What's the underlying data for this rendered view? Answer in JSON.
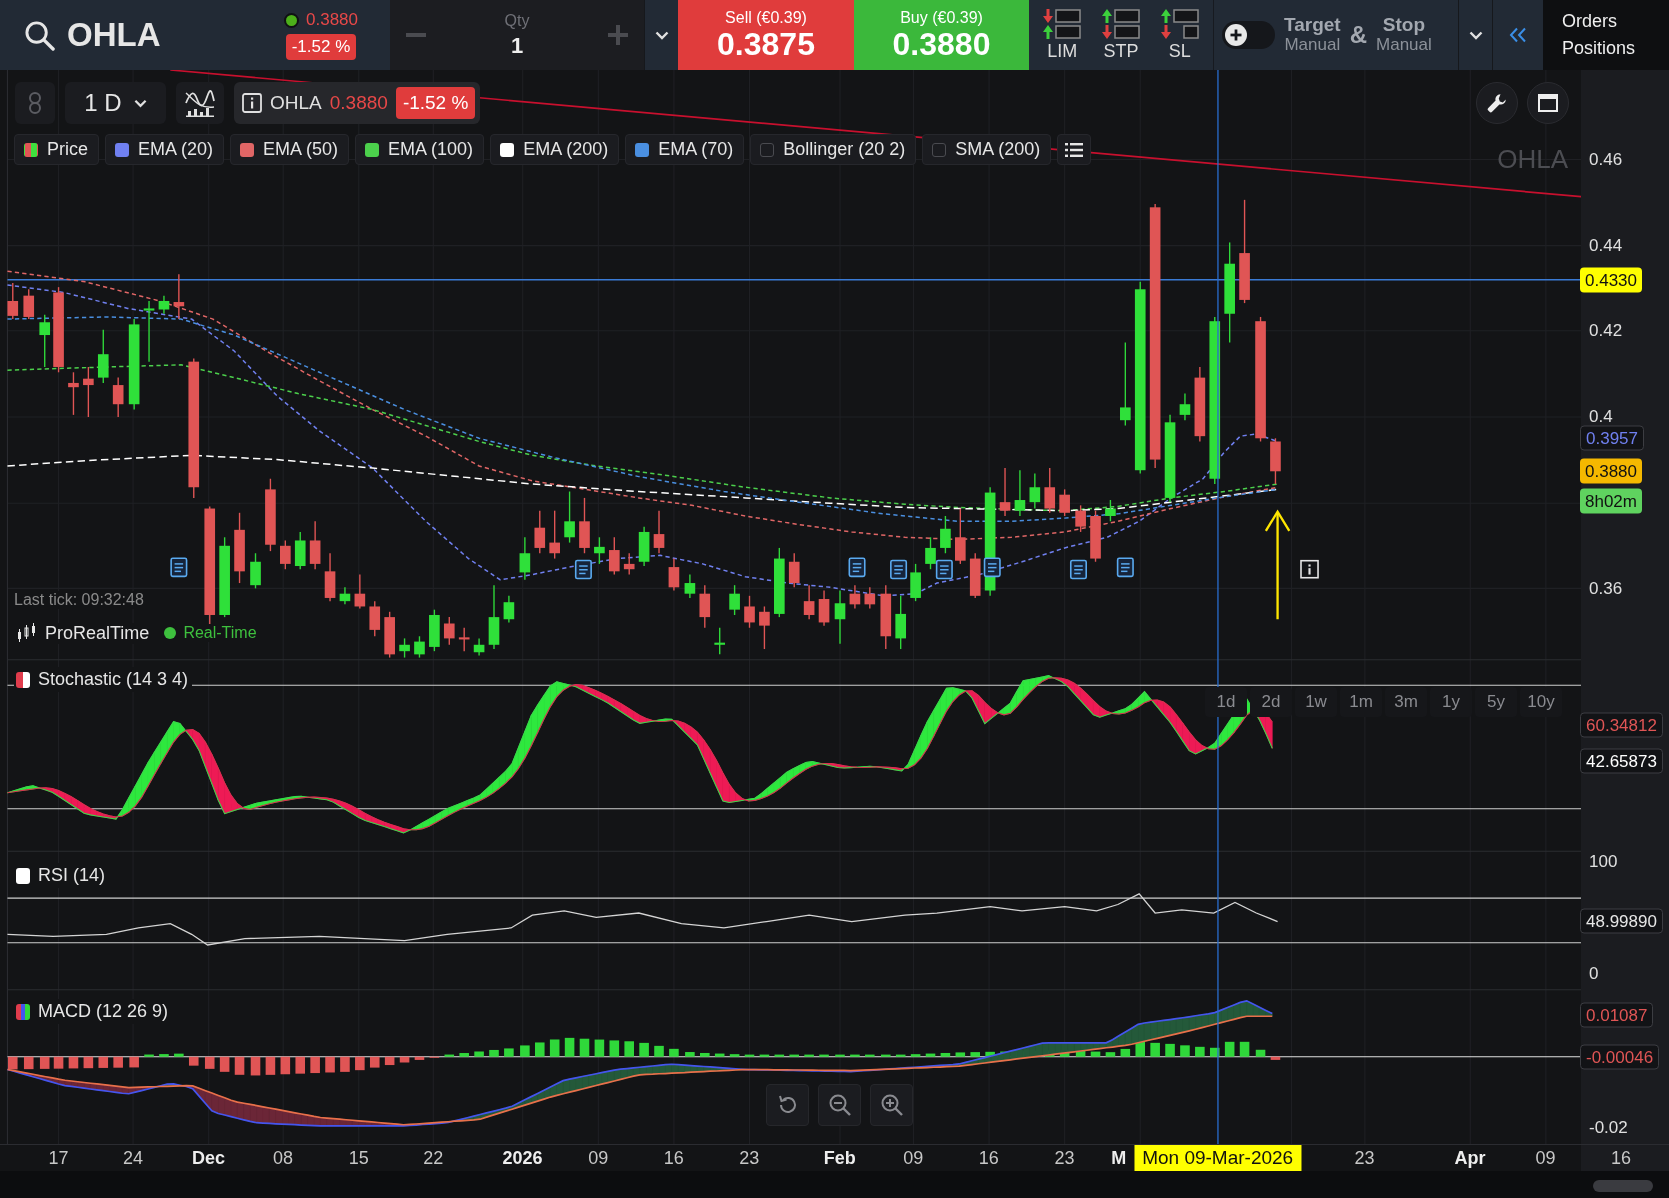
{
  "top_bar": {
    "symbol": "OHLA",
    "market_open": true,
    "price": "0.3880",
    "change": "-1.52 %",
    "quantity": {
      "label": "Qty",
      "value": "1"
    },
    "sell": {
      "label": "Sell (€0.39)",
      "price": "0.3875"
    },
    "buy": {
      "label": "Buy (€0.39)",
      "price": "0.3880"
    },
    "order_types": [
      {
        "label": "LIM",
        "kind": "limit"
      },
      {
        "label": "STP",
        "kind": "stop"
      },
      {
        "label": "SL",
        "kind": "stop_loss"
      }
    ],
    "target_stop": {
      "enabled": false,
      "target": "Target",
      "target_mode": "Manual",
      "joiner": "&",
      "stop": "Stop",
      "stop_mode": "Manual"
    },
    "panel_links": [
      "Orders",
      "Positions"
    ]
  },
  "chart_toolbar": {
    "interval": "1 D",
    "symbol": "OHLA",
    "price": "0.3880",
    "change": "-1.52 %"
  },
  "legend": [
    {
      "label": "Price",
      "kind": "candles",
      "visible": true
    },
    {
      "label": "EMA (20)",
      "kind": "line",
      "visible": true,
      "color": "#7080f0"
    },
    {
      "label": "EMA (50)",
      "kind": "line",
      "visible": true,
      "color": "#e06666"
    },
    {
      "label": "EMA (100)",
      "kind": "line",
      "visible": true,
      "color": "#4cd04c"
    },
    {
      "label": "EMA (200)",
      "kind": "line",
      "visible": true,
      "color": "#ffffff"
    },
    {
      "label": "EMA (70)",
      "kind": "line",
      "visible": true,
      "color": "#4a8fe0"
    },
    {
      "label": "Bollinger (20 2)",
      "kind": "line",
      "visible": false
    },
    {
      "label": "SMA (200)",
      "kind": "line",
      "visible": false
    }
  ],
  "symbol_label": "OHLA",
  "last_tick": "Last tick: 09:32:48",
  "data_feed": {
    "provider": "ProRealTime",
    "realtime": true,
    "status": "Real-Time"
  },
  "timeframes": [
    {
      "label": "1d",
      "selected": false
    },
    {
      "label": "2d",
      "selected": false
    },
    {
      "label": "1w",
      "selected": false
    },
    {
      "label": "1m",
      "selected": false
    },
    {
      "label": "3m",
      "selected": false
    },
    {
      "label": "1y",
      "selected": false
    },
    {
      "label": "5y",
      "selected": false
    },
    {
      "label": "10y",
      "selected": false
    }
  ],
  "price_axis": {
    "labels": [
      "0.46",
      "0.44",
      "0.42",
      "0.4",
      "0.36"
    ],
    "tags": [
      {
        "text": "0.4330",
        "kind": "filled",
        "color": "#ffff00"
      },
      {
        "text": "0.3957",
        "kind": "outlined",
        "color": "#7080f0"
      },
      {
        "text": "0.3880",
        "kind": "filled",
        "color": "#f5b800"
      },
      {
        "text": "8h02m",
        "kind": "filled",
        "color": "#5fd35f"
      }
    ]
  },
  "indicator_panes": [
    {
      "kind": "stochastic",
      "title": "Stochastic (14 3 4)",
      "tags": [
        {
          "text": "60.34812",
          "kind": "outlined",
          "color": "#e05555"
        },
        {
          "text": "42.65873",
          "kind": "outlined",
          "color": "#ffffff"
        }
      ]
    },
    {
      "kind": "rsi",
      "title": "RSI (14)",
      "axis_labels": [
        "100",
        "0"
      ],
      "tags": [
        {
          "text": "48.99890",
          "kind": "outlined",
          "color": "#e6e6e6"
        }
      ]
    },
    {
      "kind": "macd",
      "title": "MACD (12 26 9)",
      "axis_labels": [
        "-0.02"
      ],
      "tags": [
        {
          "text": "0.01087",
          "kind": "outlined",
          "color": "#e05555"
        },
        {
          "text": "-0.00046",
          "kind": "outlined",
          "color": "#e05555"
        }
      ]
    }
  ],
  "time_axis": [
    {
      "label": "17",
      "kind": "day"
    },
    {
      "label": "24",
      "kind": "day"
    },
    {
      "label": "Dec",
      "kind": "month"
    },
    {
      "label": "08",
      "kind": "day"
    },
    {
      "label": "15",
      "kind": "day"
    },
    {
      "label": "22",
      "kind": "day"
    },
    {
      "label": "2026",
      "kind": "year"
    },
    {
      "label": "09",
      "kind": "day"
    },
    {
      "label": "16",
      "kind": "day"
    },
    {
      "label": "23",
      "kind": "day"
    },
    {
      "label": "Feb",
      "kind": "month"
    },
    {
      "label": "09",
      "kind": "day"
    },
    {
      "label": "16",
      "kind": "day"
    },
    {
      "label": "23",
      "kind": "day"
    },
    {
      "label": "M",
      "kind": "month"
    },
    {
      "label": "23",
      "kind": "day"
    },
    {
      "label": "Apr",
      "kind": "month"
    },
    {
      "label": "09",
      "kind": "day"
    },
    {
      "label": "16",
      "kind": "day"
    }
  ],
  "crosshair": {
    "date": "Mon 09-Mar-2026"
  }
}
